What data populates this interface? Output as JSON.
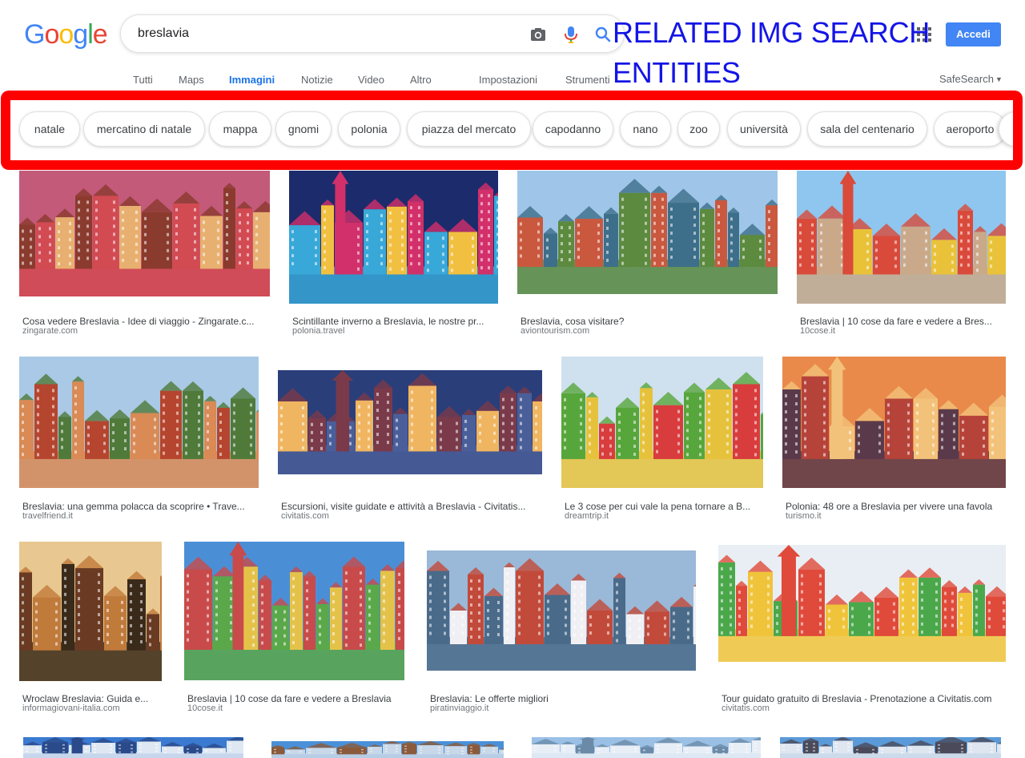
{
  "header": {
    "logo": [
      "G",
      "o",
      "o",
      "g",
      "l",
      "e"
    ],
    "logo_colors": [
      "#4285f4",
      "#ea4335",
      "#fbbc05",
      "#4285f4",
      "#34a853",
      "#ea4335"
    ],
    "query": "breslavia",
    "login_label": "Accedi",
    "icons": [
      "camera-icon",
      "microphone-icon",
      "search-icon",
      "apps-grid-icon"
    ]
  },
  "annotation": {
    "line1": "RELATED IMG SEARCH",
    "line2": "ENTITIES",
    "color": "#1414e6",
    "box_color": "#ff0000"
  },
  "tabs": {
    "all": "Tutti",
    "maps": "Maps",
    "images": "Immagini",
    "news": "Notizie",
    "video": "Video",
    "more": "Altro",
    "settings": "Impostazioni",
    "tools": "Strumenti",
    "safesearch": "SafeSearch",
    "active_color": "#1a73e8"
  },
  "chips": [
    "natale",
    "mercatino di natale",
    "mappa",
    "gnomi",
    "polonia",
    "piazza del mercato",
    "capodanno",
    "nano",
    "zoo",
    "università",
    "sala del centenario",
    "aeroporto"
  ],
  "results": [
    {
      "caption": "Cosa vedere Breslavia - Idee di viaggio - Zingarate.c...",
      "domain": "zingarate.com",
      "palette": [
        "#c35a7a",
        "#e8b070",
        "#8b3a2e",
        "#d24a52"
      ]
    },
    {
      "caption": "Scintillante inverno a Breslavia, le nostre pr...",
      "domain": "polonia.travel",
      "palette": [
        "#1c2b6b",
        "#f2c040",
        "#d2306a",
        "#38a8d8"
      ]
    },
    {
      "caption": "Breslavia, cosa visitare?",
      "domain": "aviontourism.com",
      "palette": [
        "#9fc6e8",
        "#c9583e",
        "#3d6e8a",
        "#5c8a3e"
      ]
    },
    {
      "caption": "Breslavia | 10 cose da fare e vedere a Bres...",
      "domain": "10cose.it",
      "palette": [
        "#8ec6ef",
        "#e9c23a",
        "#d94a3a",
        "#c9a98a"
      ]
    },
    {
      "caption": "Breslavia: una gemma polacca da scoprire • Trave...",
      "domain": "travelfriend.it",
      "palette": [
        "#a9c9e6",
        "#b5452e",
        "#4f7a3a",
        "#d98a55"
      ]
    },
    {
      "caption": "Escursioni, visite guidate e attività a Breslavia - Civitatis...",
      "domain": "civitatis.com",
      "palette": [
        "#2a3f7a",
        "#f0b560",
        "#7a3a4a",
        "#4a5f9a"
      ]
    },
    {
      "caption": "Le 3 cose per cui vale la pena tornare a B...",
      "domain": "dreamtrip.it",
      "palette": [
        "#cfe0ef",
        "#d83c3c",
        "#57a63c",
        "#e6c23c"
      ]
    },
    {
      "caption": "Polonia: 48 ore a Breslavia per vivere una favola",
      "domain": "turismo.it",
      "palette": [
        "#e98a4a",
        "#b6433a",
        "#f3c27a",
        "#5a3a4a"
      ]
    },
    {
      "caption": "Wroclaw Breslavia: Guida e...",
      "domain": "informagiovani-italia.com",
      "palette": [
        "#e8c890",
        "#6a3a22",
        "#c07a3a",
        "#3a2a1a"
      ]
    },
    {
      "caption": "Breslavia | 10 cose da fare e vedere a Breslavia",
      "domain": "10cose.it",
      "palette": [
        "#4a8fd6",
        "#e4c24a",
        "#c84a4a",
        "#5aa84a"
      ]
    },
    {
      "caption": "Breslavia: Le offerte migliori",
      "domain": "piratinviaggio.it",
      "palette": [
        "#9ab8d8",
        "#f0f0f4",
        "#c24a3a",
        "#4a6a8a"
      ]
    },
    {
      "caption": "Tour guidato gratuito di Breslavia - Prenotazione a Civitatis.com",
      "domain": "civitatis.com",
      "palette": [
        "#e8eef4",
        "#4aa84a",
        "#e04a3a",
        "#f0c43a"
      ]
    }
  ],
  "bottom_row_palettes": [
    [
      "#3a7ad0",
      "#dfe8f2",
      "#2a4a8a"
    ],
    [
      "#4a90d8",
      "#c8d8e8",
      "#8a5a3a"
    ],
    [
      "#9ac0e6",
      "#e8eef6",
      "#6a8aa8"
    ],
    [
      "#5a9ad8",
      "#dfe6f0",
      "#4a4a5a"
    ]
  ]
}
